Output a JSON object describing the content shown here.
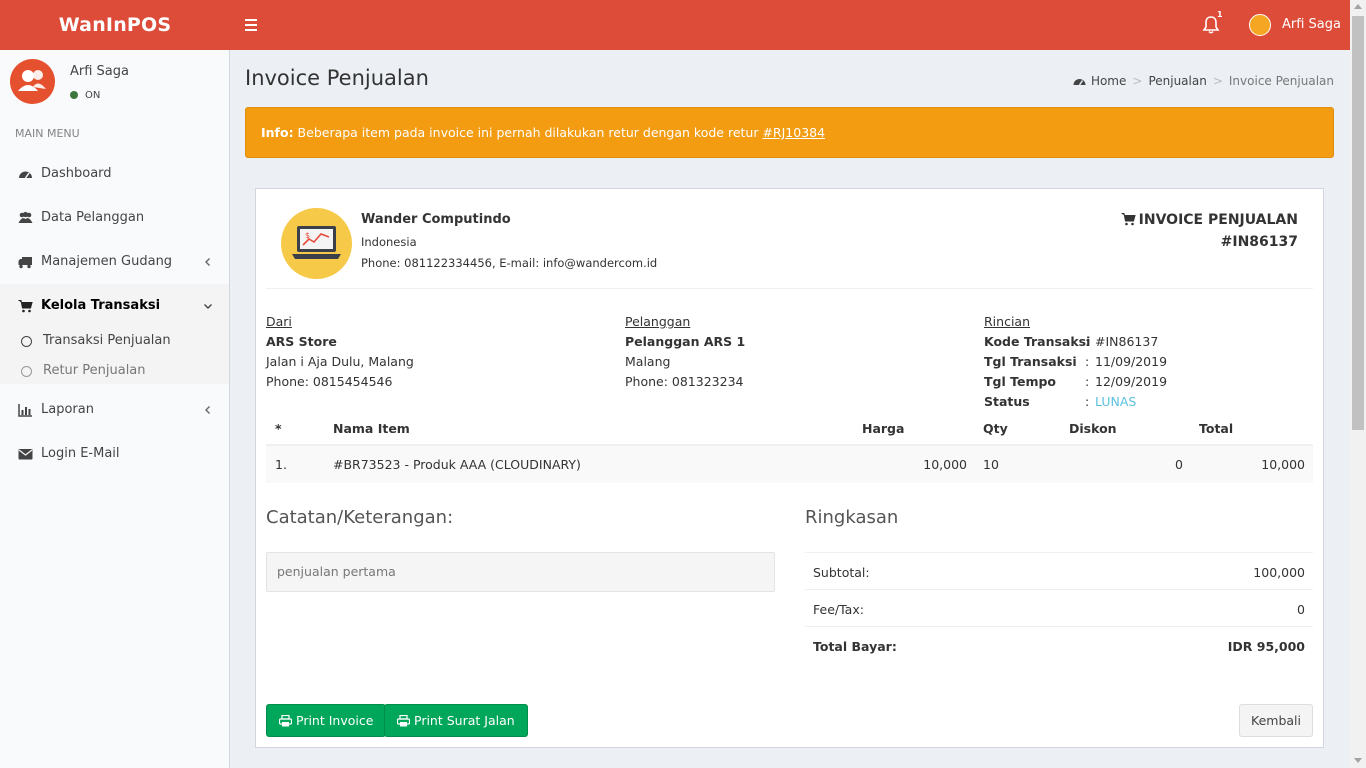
{
  "app": {
    "brand": "WanInPOS",
    "user_name": "Arfi Saga",
    "notification_count": "1"
  },
  "sidebar": {
    "user_name": "Arfi Saga",
    "status": "ON",
    "menu_header": "MAIN MENU",
    "items": [
      {
        "label": "Dashboard",
        "icon": "dashboard-icon"
      },
      {
        "label": "Data Pelanggan",
        "icon": "users-icon"
      },
      {
        "label": "Manajemen Gudang",
        "icon": "truck-icon"
      },
      {
        "label": "Kelola Transaksi",
        "icon": "cart-icon"
      },
      {
        "label": "Laporan",
        "icon": "bar-chart-icon"
      },
      {
        "label": "Login E-Mail",
        "icon": "envelope-icon"
      }
    ],
    "submenu": [
      {
        "label": "Transaksi Penjualan"
      },
      {
        "label": "Retur Penjualan"
      }
    ]
  },
  "page": {
    "title": "Invoice Penjualan",
    "breadcrumb": [
      "Home",
      "Penjualan",
      "Invoice Penjualan"
    ]
  },
  "alert": {
    "prefix": "Info:",
    "message": " Beberapa item pada invoice ini pernah dilakukan retur dengan kode retur ",
    "link": "#RJ10384"
  },
  "invoice": {
    "company": {
      "name": "Wander Computindo",
      "country": "Indonesia",
      "contact": "Phone: 081122334456, E-mail: info@wandercom.id"
    },
    "title": "INVOICE PENJUALAN",
    "code": "#IN86137",
    "from": {
      "label": "Dari",
      "name": "ARS Store",
      "address": "Jalan i Aja Dulu, Malang",
      "phone": "Phone: 0815454546"
    },
    "customer": {
      "label": "Pelanggan",
      "name": "Pelanggan ARS 1",
      "address": "Malang",
      "phone": "Phone: 081323234"
    },
    "details": {
      "label": "Rincian",
      "rows": [
        {
          "key": "Kode Transaksi",
          "value": "#IN86137"
        },
        {
          "key": "Tgl Transaksi",
          "value": "11/09/2019"
        },
        {
          "key": "Tgl Tempo",
          "value": "12/09/2019"
        },
        {
          "key": "Status",
          "value": "LUNAS"
        }
      ],
      "colon": ":"
    },
    "table": {
      "headers": [
        "*",
        "Nama Item",
        "Harga",
        "Qty",
        "Diskon",
        "Total"
      ],
      "rows": [
        {
          "no": "1.",
          "item": "#BR73523 - Produk AAA (CLOUDINARY)",
          "price": "10,000",
          "qty": "10",
          "discount": "0",
          "total": "10,000"
        }
      ]
    },
    "notes": {
      "title": "Catatan/Keterangan:",
      "text": "penjualan pertama"
    },
    "summary": {
      "title": "Ringkasan",
      "rows": [
        {
          "label": "Subtotal:",
          "value": "100,000"
        },
        {
          "label": "Fee/Tax:",
          "value": "0"
        },
        {
          "label": "Total Bayar:",
          "value": "IDR 95,000"
        }
      ]
    },
    "buttons": {
      "print_invoice": "Print Invoice",
      "print_delivery": "Print Surat Jalan",
      "back": "Kembali"
    }
  },
  "colors": {
    "topbar": "#dd4b39",
    "alert": "#f39c12",
    "success": "#00a65a",
    "status_lunas": "#5bc0de"
  }
}
